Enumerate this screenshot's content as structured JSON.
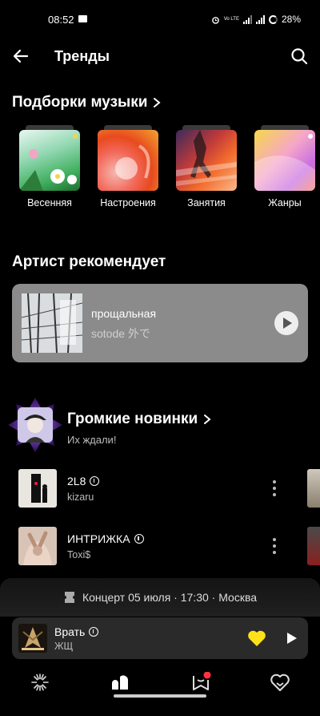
{
  "status_bar": {
    "time": "08:52",
    "network": "Vo LTE",
    "battery": "28%"
  },
  "header": {
    "title": "Тренды"
  },
  "collections": {
    "title": "Подборки музыки",
    "items": [
      {
        "label": "Весенняя"
      },
      {
        "label": "Настроения"
      },
      {
        "label": "Занятия"
      },
      {
        "label": "Жанры"
      }
    ]
  },
  "artist_recommends": {
    "title": "Артист рекомендует",
    "track": {
      "title": "прощальная",
      "artist": "sotode 外で"
    }
  },
  "loud_new": {
    "title": "Громкие новинки",
    "subtitle": "Их ждали!",
    "tracks": [
      {
        "title": "2L8",
        "artist": "kizaru",
        "explicit": true
      },
      {
        "title": "ИНТРИЖКА",
        "artist": "Toxi$",
        "explicit": true
      }
    ]
  },
  "concert_banner": {
    "text": "Концерт 05 июля · 17:30 · Москва"
  },
  "player": {
    "title": "Врать",
    "artist": "ЖЩ",
    "explicit": true,
    "liked": true,
    "accent": "#ffe11a"
  },
  "bottom_nav": {
    "items": [
      {
        "icon": "sparkle-icon"
      },
      {
        "icon": "music-icon",
        "active": true
      },
      {
        "icon": "collection-icon",
        "badge": true
      },
      {
        "icon": "heart-home-icon"
      }
    ]
  },
  "colors": {
    "background": "#000000",
    "card": "#8b8b8b",
    "player_bg": "#2a2a2a",
    "badge": "#ff3340"
  }
}
